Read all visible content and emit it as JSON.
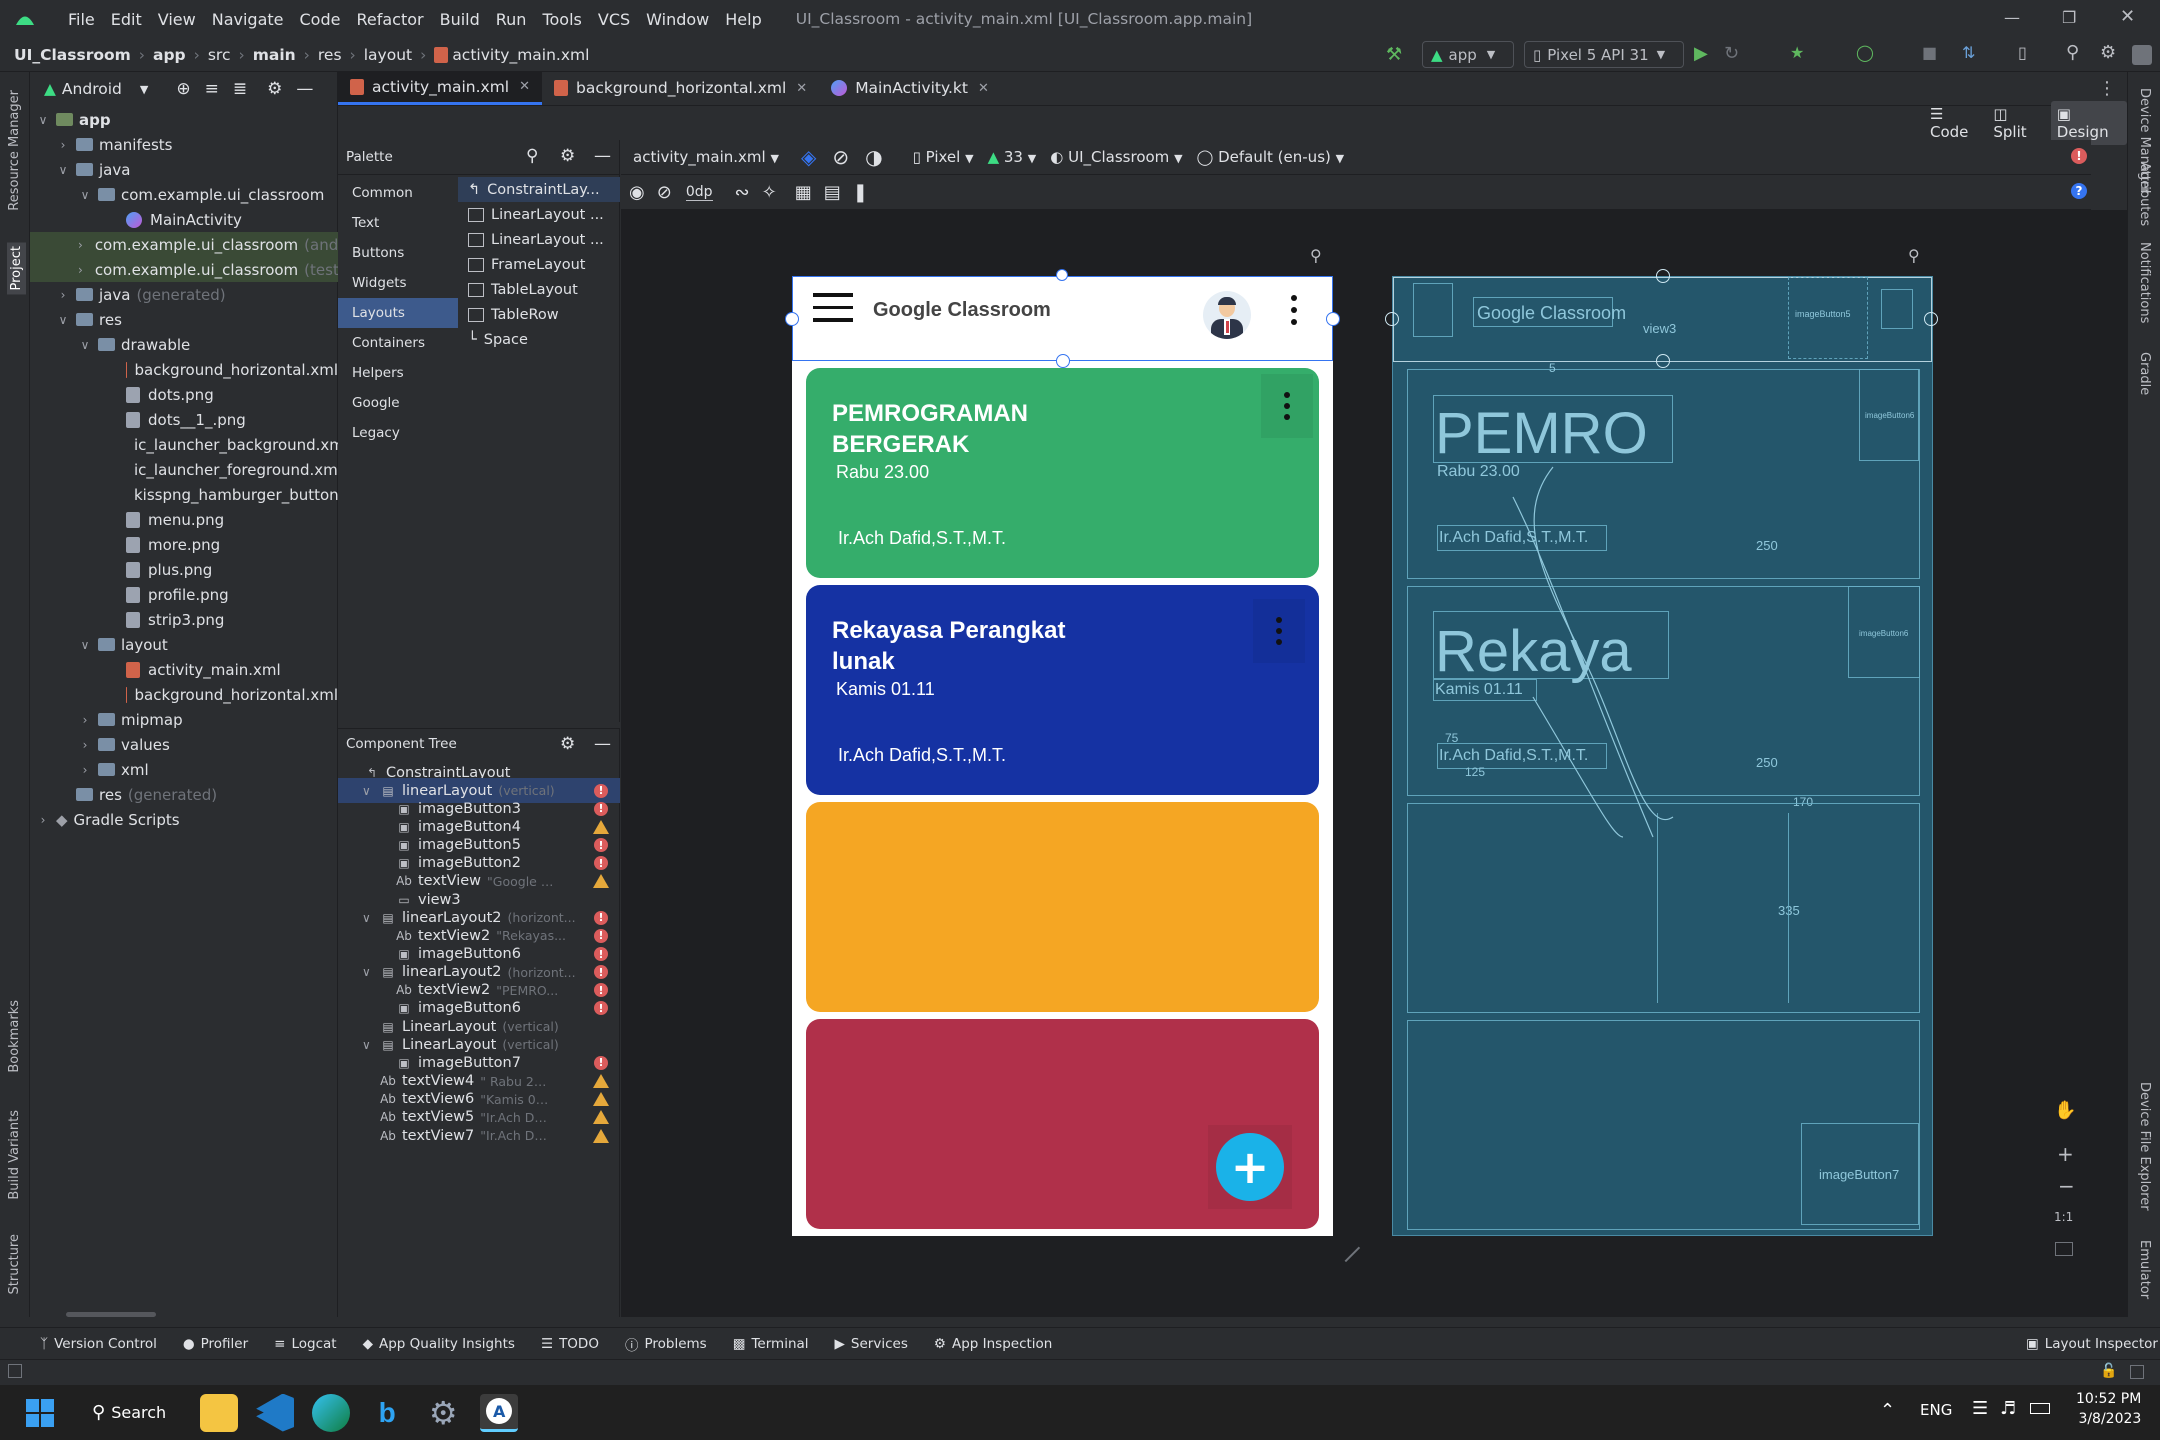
{
  "menubar": {
    "items": [
      "File",
      "Edit",
      "View",
      "Navigate",
      "Code",
      "Refactor",
      "Build",
      "Run",
      "Tools",
      "VCS",
      "Window",
      "Help"
    ],
    "window_title": "UI_Classroom - activity_main.xml [UI_Classroom.app.main]"
  },
  "navbar": {
    "crumbs": [
      "UI_Classroom",
      "app",
      "src",
      "main",
      "res",
      "layout",
      "activity_main.xml"
    ],
    "run_config": "app",
    "device": "Pixel 5 API 31"
  },
  "left_stripe": {
    "resource_manager": "Resource Manager",
    "project": "Project",
    "bookmarks": "Bookmarks",
    "build_variants": "Build Variants",
    "structure": "Structure"
  },
  "right_stripe": {
    "device_manager": "Device Manager",
    "attributes": "Attributes",
    "notifications": "Notifications",
    "gradle": "Gradle",
    "device_file_explorer": "Device File Explorer",
    "emulator": "Emulator"
  },
  "project_panel": {
    "view_mode": "Android",
    "tree": [
      {
        "label": "app",
        "bold": true
      },
      {
        "label": "manifests"
      },
      {
        "label": "java"
      },
      {
        "label": "com.example.ui_classroom"
      },
      {
        "label": "MainActivity"
      },
      {
        "label": "com.example.ui_classroom",
        "suffix": "(and"
      },
      {
        "label": "com.example.ui_classroom",
        "suffix": "(test"
      },
      {
        "label": "java",
        "suffix": "(generated)"
      },
      {
        "label": "res"
      },
      {
        "label": "drawable"
      },
      {
        "label": "background_horizontal.xml"
      },
      {
        "label": "dots.png"
      },
      {
        "label": "dots__1_.png"
      },
      {
        "label": "ic_launcher_background.xml"
      },
      {
        "label": "ic_launcher_foreground.xml",
        "suffix": "("
      },
      {
        "label": "kisspng_hamburger_button_r"
      },
      {
        "label": "menu.png"
      },
      {
        "label": "more.png"
      },
      {
        "label": "plus.png"
      },
      {
        "label": "profile.png"
      },
      {
        "label": "strip3.png"
      },
      {
        "label": "layout"
      },
      {
        "label": "activity_main.xml"
      },
      {
        "label": "background_horizontal.xml"
      },
      {
        "label": "mipmap"
      },
      {
        "label": "values"
      },
      {
        "label": "xml"
      },
      {
        "label": "res",
        "suffix": "(generated)"
      },
      {
        "label": "Gradle Scripts"
      }
    ]
  },
  "editor_tabs": [
    {
      "label": "activity_main.xml",
      "active": true
    },
    {
      "label": "background_horizontal.xml",
      "active": false
    },
    {
      "label": "MainActivity.kt",
      "active": false
    }
  ],
  "view_modes": {
    "code": "Code",
    "split": "Split",
    "design": "Design"
  },
  "palette": {
    "title": "Palette",
    "categories": [
      "Common",
      "Text",
      "Buttons",
      "Widgets",
      "Layouts",
      "Containers",
      "Helpers",
      "Google",
      "Legacy"
    ],
    "active_category": "Layouts",
    "items": [
      "ConstraintLay...",
      "LinearLayout ...",
      "LinearLayout ...",
      "FrameLayout",
      "TableLayout",
      "TableRow",
      "Space"
    ]
  },
  "design_toolbar": {
    "file": "activity_main.xml",
    "device": "Pixel",
    "api": "33",
    "theme": "UI_Classroom",
    "locale": "Default (en-us)",
    "margin": "0dp"
  },
  "component_tree": {
    "title": "Component Tree",
    "rows": [
      {
        "label": "ConstraintLayout",
        "sub": "",
        "status": "none"
      },
      {
        "label": "linearLayout",
        "sub": "(vertical)",
        "status": "error"
      },
      {
        "label": "imageButton3",
        "sub": "",
        "status": "error"
      },
      {
        "label": "imageButton4",
        "sub": "",
        "status": "warn"
      },
      {
        "label": "imageButton5",
        "sub": "",
        "status": "error"
      },
      {
        "label": "imageButton2",
        "sub": "",
        "status": "error"
      },
      {
        "label": "textView",
        "sub": "\"Google C...",
        "status": "warn"
      },
      {
        "label": "view3",
        "sub": "",
        "status": "none"
      },
      {
        "label": "linearLayout2",
        "sub": "(horizont...",
        "status": "error"
      },
      {
        "label": "textView2",
        "sub": "\"Rekayas...",
        "status": "error"
      },
      {
        "label": "imageButton6",
        "sub": "",
        "status": "error"
      },
      {
        "label": "linearLayout2",
        "sub": "(horizont...",
        "status": "error"
      },
      {
        "label": "textView2",
        "sub": "\"PEMRO...",
        "status": "error"
      },
      {
        "label": "imageButton6",
        "sub": "",
        "status": "error"
      },
      {
        "label": "LinearLayout",
        "sub": "(vertical)",
        "status": "none"
      },
      {
        "label": "LinearLayout",
        "sub": "(vertical)",
        "status": "none"
      },
      {
        "label": "imageButton7",
        "sub": "",
        "status": "error"
      },
      {
        "label": "textView4",
        "sub": "\" Rabu 23.00\"",
        "status": "warn"
      },
      {
        "label": "textView6",
        "sub": "\"Kamis 01.11\"",
        "status": "warn"
      },
      {
        "label": "textView5",
        "sub": "\"Ir.Ach Dafid,...",
        "status": "warn"
      },
      {
        "label": "textView7",
        "sub": "\"Ir.Ach Dafid,...",
        "status": "warn"
      }
    ]
  },
  "phone": {
    "app_title": "Google Classroom",
    "cards": [
      {
        "title": "PEMROGRAMAN BERGERAK",
        "time": "Rabu 23.00",
        "teacher": "Ir.Ach Dafid,S.T.,M.T.",
        "color": "#35ad6b"
      },
      {
        "title": "Rekayasa Perangkat lunak",
        "time": "Kamis 01.11",
        "teacher": "Ir.Ach Dafid,S.T.,M.T.",
        "color": "#1532a3"
      },
      {
        "title": "",
        "time": "",
        "teacher": "",
        "color": "#f5a623"
      },
      {
        "title": "",
        "time": "",
        "teacher": "",
        "color": "#b0304a"
      }
    ],
    "fab_color": "#1ab2e8"
  },
  "blueprint": {
    "app_title": "Google Classroom",
    "view3": "view3",
    "imageButton5": "imageButton5",
    "imageButton6": "imageButton6",
    "imageButton7": "imageButton7",
    "big1": "PEMRO",
    "time1": "Rabu 23.00",
    "teacher1": "Ir.Ach Dafid,S.T.,M.T.",
    "big2": "Rekaya",
    "time2": "Kamis 01.11",
    "teacher2": "Ir.Ach Dafid,S.T.,M.T.",
    "dim_250a": "250",
    "dim_250b": "250",
    "dim_335": "335",
    "dim_75": "75",
    "dim_125": "125",
    "dim_170": "170",
    "dim_5": "5"
  },
  "zoom_controls": {
    "ratio": "1:1"
  },
  "bottom_tools": [
    "Version Control",
    "Profiler",
    "Logcat",
    "App Quality Insights",
    "TODO",
    "Problems",
    "Terminal",
    "Services",
    "App Inspection"
  ],
  "layout_inspector": "Layout Inspector",
  "taskbar": {
    "search": "Search",
    "lang": "ENG",
    "time": "10:52 PM",
    "date": "3/8/2023"
  }
}
